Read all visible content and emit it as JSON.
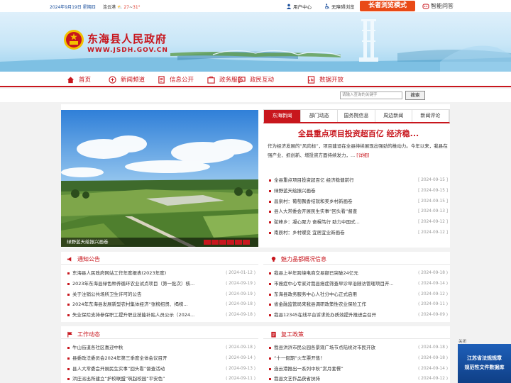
{
  "topbar": {
    "date": "2024年9月19日  星期四",
    "city": "连云港",
    "temp_low": "27",
    "temp_sep": "~",
    "temp_high": "31°",
    "user_center": "用户中心",
    "accessibility": "无障碍浏览",
    "elder_mode": "长者浏览模式",
    "smart_qa": "智能问答"
  },
  "banner": {
    "title": "东海县人民政府",
    "url": "WWW.JSDH.GOV.CN"
  },
  "nav": {
    "items": [
      {
        "label": "首页",
        "icon": "home-icon"
      },
      {
        "label": "新闻频道",
        "icon": "news-icon"
      },
      {
        "label": "信息公开",
        "icon": "document-icon"
      },
      {
        "label": "政务服务",
        "icon": "service-icon"
      },
      {
        "label": "政民互动",
        "icon": "interaction-icon"
      },
      {
        "label": "数据开放",
        "icon": "data-icon"
      }
    ]
  },
  "search": {
    "placeholder": "请输入查询的关键字",
    "button": "搜索"
  },
  "slideshow": {
    "caption": "绿野蓝天绘振兴画卷"
  },
  "news_tabs": {
    "tabs": [
      "东海新闻",
      "部门动态",
      "国务院信息",
      "周边新闻",
      "新闻评论"
    ],
    "active": 0,
    "headline": "全县重点项目投资超百亿 经济稳...",
    "summary": "作为经济发展的“风向标”，项目建设在全县持续展现出强劲的推动力。今年以来，我县在强产业、抓创新、增投资方面持续发力，...",
    "more": "[详细]",
    "items": [
      {
        "title": "全县重点项目投资超百亿 经济稳健前行",
        "date": "[ 2024-09-15 ]"
      },
      {
        "title": "绿野蓝天绘振兴画卷",
        "date": "[ 2024-09-15 ]"
      },
      {
        "title": "昌泉村：葡萄飘香结就和美乡村新画卷",
        "date": "[ 2024-09-15 ]"
      },
      {
        "title": "县人大常委会开展民生实事“回头看”督查",
        "date": "[ 2024-09-13 ]"
      },
      {
        "title": "驼峰乡：凝心聚力 奋楫笃行 助力中国式...",
        "date": "[ 2024-09-12 ]"
      },
      {
        "title": "南辰村：乡村蝶变 宜居宜业新画卷",
        "date": "[ 2024-09-12 ]"
      }
    ]
  },
  "notice": {
    "title": "通知公告",
    "items": [
      {
        "title": "东海县人民政府网站工作年度报表(2023年度)",
        "date": "( 2024-01-12 )"
      },
      {
        "title": "2023年东海县绿色种养循环农业试点项目（第一批次）核...",
        "date": "( 2024-09-19 )"
      },
      {
        "title": "关于注销公共场所卫生许可的公告",
        "date": "( 2024-09-19 )"
      },
      {
        "title": "2024年东海县发展新型农村集体经济“张榜招贤、揭榜...",
        "date": "( 2024-09-18 )"
      },
      {
        "title": "失业保险支持参保职工提升职业技能补贴人员公示（2024...",
        "date": "( 2024-09-18 )"
      }
    ]
  },
  "charm": {
    "title": "魅力晶都概况信息",
    "items": [
      {
        "title": "我县上半年跨境电商交易额已突破24亿元",
        "date": "( 2024-09-18 )"
      },
      {
        "title": "市癌症中心专家对我县癌症筛查早诊早治随访管理项目开...",
        "date": "( 2024-09-14 )"
      },
      {
        "title": "东海县政务服务中心人社分中心正式启用",
        "date": "( 2024-09-12 )"
      },
      {
        "title": "省金融监管局来我县调研政策性农业保险工作",
        "date": "( 2024-09-11 )"
      },
      {
        "title": "我县12345在线平台诉求处办质效提升推进会召开",
        "date": "( 2024-09-09 )"
      }
    ]
  },
  "work": {
    "title": "工作动态",
    "items": [
      {
        "title": "牛山街道各社区喜迎中秋",
        "date": "( 2024-09-18 )"
      },
      {
        "title": "县委政法委员会2024年第三季度全体会议召开",
        "date": "( 2024-09-14 )"
      },
      {
        "title": "县人大常委会开展民生实事“回头看”督查活动",
        "date": "( 2024-09-13 )"
      },
      {
        "title": "洪庄派出所建立“护校联盟”筑起校园“平安色”",
        "date": "( 2024-09-11 )"
      }
    ]
  },
  "reopen": {
    "title": "复工政策",
    "items": [
      {
        "title": "我县洪浜市民公园各景观广场节点陆续对市民开放",
        "date": "( 2024-09-18 )"
      },
      {
        "title": "“十一假期”火车票开售！",
        "date": "( 2024-09-18 )"
      },
      {
        "title": "连云港推出一系列中秋“赏月套餐”",
        "date": "( 2024-09-14 )"
      },
      {
        "title": "我县文艺作品获省扶持",
        "date": "( 2024-09-12 )"
      }
    ]
  },
  "float_ad": {
    "close": "关闭",
    "line1": "江苏省法规规章",
    "line2": "规范性文件数据库"
  },
  "colors": {
    "brand_red": "#c8161d",
    "elder_orange": "#e94a16",
    "link_blue": "#1a4f9c"
  }
}
